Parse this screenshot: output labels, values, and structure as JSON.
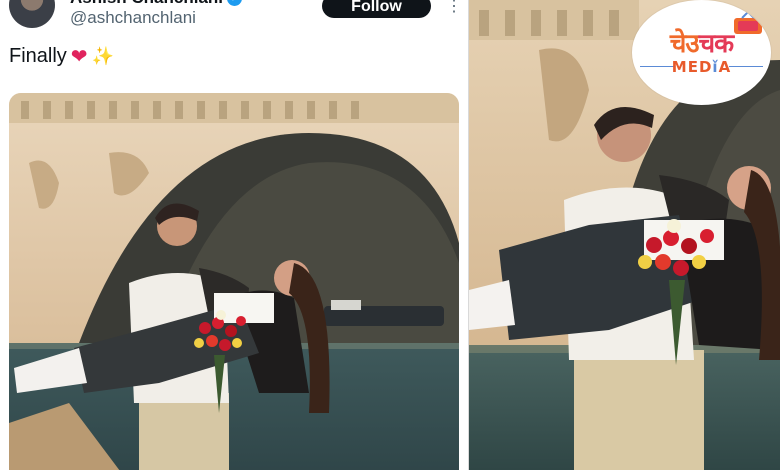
{
  "tweet": {
    "author_name": "Ashish Chanchlani",
    "handle": "@ashchanchlani",
    "follow_label": "Follow",
    "text": "Finally",
    "emojis": [
      "red-heart",
      "sparkles"
    ]
  },
  "watermark": {
    "word_part1": "चेउ",
    "word_part2": "चक",
    "media_label": "MED",
    "media_label_end": "A"
  },
  "colors": {
    "follow_bg": "#0f1419",
    "verified": "#1d9bf0",
    "heart": "#e0245e",
    "logo_orange": "#f06a2b",
    "logo_pink": "#e43a57"
  }
}
